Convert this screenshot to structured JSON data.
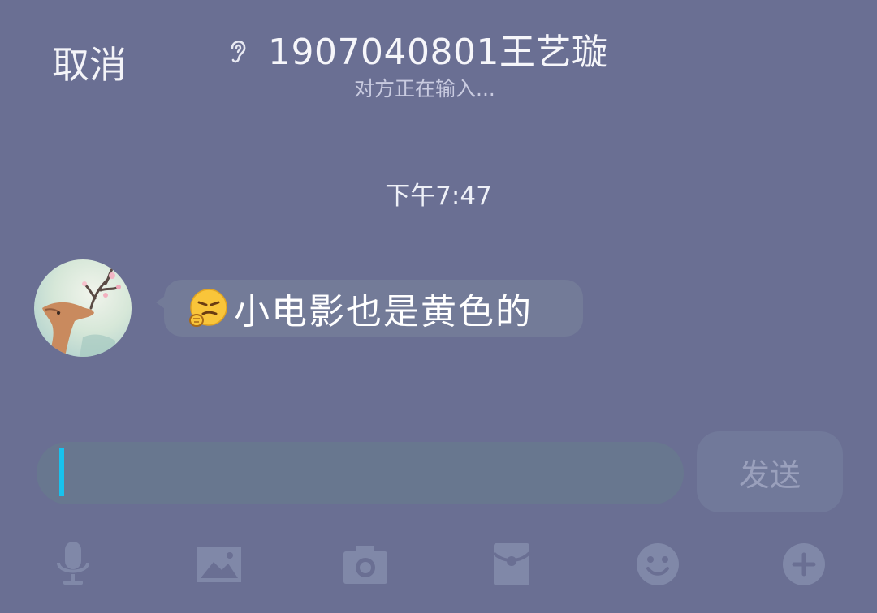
{
  "header": {
    "cancel_label": "取消",
    "title": "1907040801王艺璇",
    "subtitle": "对方正在输入..."
  },
  "chat": {
    "timestamp": "下午7:47",
    "messages": [
      {
        "sender": "contact",
        "emoji": "smirk-face-emoji",
        "text": "小电影也是黄色的"
      }
    ]
  },
  "composer": {
    "input_value": "",
    "send_label": "发送"
  },
  "toolbar": {
    "icons": [
      "microphone-icon",
      "image-icon",
      "camera-icon",
      "red-packet-icon",
      "emoji-face-icon",
      "plus-icon"
    ]
  },
  "colors": {
    "background": "#6a6f93",
    "bubble": "#737b98",
    "input": "#68778f",
    "caret": "#18c2ee",
    "toolbar_icons": "#8088a8"
  }
}
